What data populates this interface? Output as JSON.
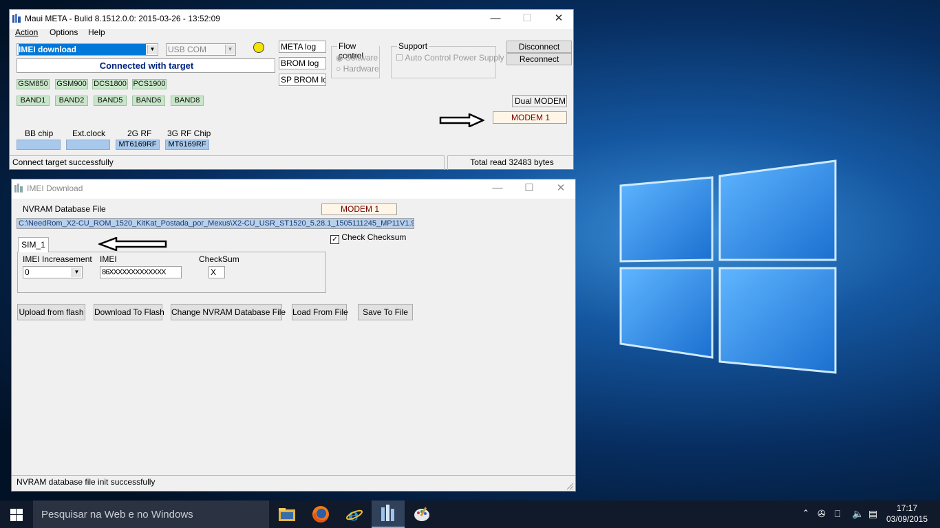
{
  "meta_window": {
    "title": "Maui META - Bulid 8.1512.0.0: 2015-03-26 - 13:52:09",
    "menu": [
      "Action",
      "Options",
      "Help"
    ],
    "mode_combo": "IMEI download",
    "port_combo": "USB COM",
    "status_indicator_color": "#f4e400",
    "connection_status": "Connected with target",
    "log_buttons": [
      "META log",
      "BROM log",
      "SP BROM log"
    ],
    "flow_control": {
      "label": "Flow control",
      "options": [
        "Software",
        "Hardware"
      ],
      "selected": "Software"
    },
    "support": {
      "label": "Support",
      "checkbox_label": "Auto Control Power Supply",
      "checked": false
    },
    "disconnect_label": "Disconnect",
    "reconnect_label": "Reconnect",
    "gsm_bands": [
      "GSM850",
      "GSM900",
      "DCS1800",
      "PCS1900"
    ],
    "umts_bands": [
      "BAND1",
      "BAND2",
      "BAND5",
      "BAND6",
      "BAND8"
    ],
    "dual_modem_label": "Dual MODEM",
    "modem_label": "MODEM 1",
    "chips": [
      {
        "label": "BB chip",
        "value": ""
      },
      {
        "label": "Ext.clock",
        "value": ""
      },
      {
        "label": "2G RF",
        "value": "MT6169RF"
      },
      {
        "label": "3G RF Chip",
        "value": "MT6169RF"
      }
    ],
    "status_left": "Connect target successfully",
    "status_right": "Total read 32483 bytes"
  },
  "imei_window": {
    "title": "IMEI Download",
    "nvram_label": "NVRAM Database File",
    "modem_label": "MODEM 1",
    "nvram_path": "C:\\NeedRom_X2-CU_ROM_1520_KitKat_Postada_por_Mexus\\X2-CU_USR_ST1520_5.28.1_1505111245_MP11V1.9_(",
    "check_checksum_label": "Check Checksum",
    "check_checksum_checked": true,
    "tab_label": "SIM_1",
    "imei_increasement_label": "IMEI Increasement",
    "imei_increasement_value": "0",
    "imei_label": "IMEI",
    "imei_value": "86XXXXXXXXXXXXX",
    "checksum_label": "CheckSum",
    "checksum_value": "X",
    "buttons": [
      "Upload from flash",
      "Download To Flash",
      "Change NVRAM Database File",
      "Load From File",
      "Save To File"
    ],
    "status": "NVRAM database file init successfully"
  },
  "taskbar": {
    "search_placeholder": "Pesquisar na Web e no Windows",
    "time": "17:17",
    "date": "03/09/2015",
    "pinned": [
      "file-explorer-icon",
      "firefox-icon",
      "internet-explorer-icon",
      "maui-meta-icon",
      "paint-icon"
    ]
  }
}
